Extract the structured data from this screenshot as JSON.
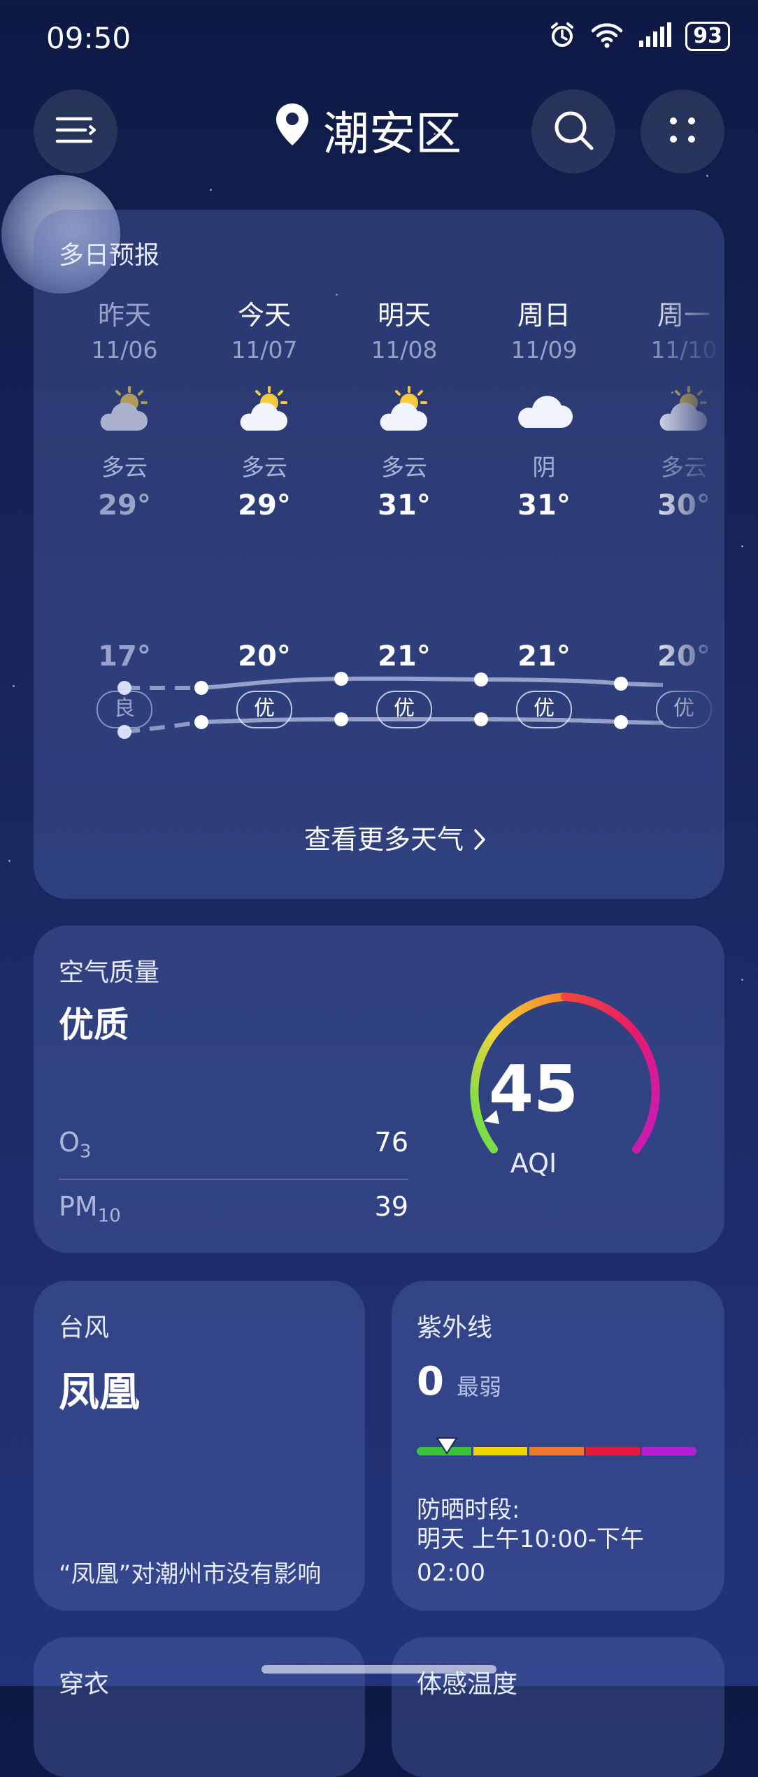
{
  "status_bar": {
    "time": "09:50",
    "battery": "93"
  },
  "header": {
    "location": "潮安区"
  },
  "forecast": {
    "title": "多日预报",
    "days": [
      {
        "name": "昨天",
        "date": "11/06",
        "condition": "多云",
        "high": "29°",
        "low": "17°",
        "aqi": "良",
        "icon": "partly-cloudy-icon"
      },
      {
        "name": "今天",
        "date": "11/07",
        "condition": "多云",
        "high": "29°",
        "low": "20°",
        "aqi": "优",
        "icon": "partly-cloudy-icon"
      },
      {
        "name": "明天",
        "date": "11/08",
        "condition": "多云",
        "high": "31°",
        "low": "21°",
        "aqi": "优",
        "icon": "partly-cloudy-icon"
      },
      {
        "name": "周日",
        "date": "11/09",
        "condition": "阴",
        "high": "31°",
        "low": "21°",
        "aqi": "优",
        "icon": "cloud-icon"
      },
      {
        "name": "周一",
        "date": "11/10",
        "condition": "多云",
        "high": "30°",
        "low": "20°",
        "aqi": "优",
        "icon": "partly-cloudy-icon"
      }
    ],
    "more_link": "查看更多天气"
  },
  "air_quality": {
    "label": "空气质量",
    "level": "优质",
    "pollutants": [
      {
        "name": "O",
        "sub": "3",
        "value": "76"
      },
      {
        "name": "PM",
        "sub": "10",
        "value": "39"
      }
    ],
    "aqi": "45",
    "aqi_unit": "AQI",
    "aqi_fraction": 0.09
  },
  "typhoon": {
    "title": "台风",
    "name": "凤凰",
    "note": "“凤凰”对潮州市没有影响"
  },
  "uv": {
    "title": "紫外线",
    "value": "0",
    "level": "最弱",
    "protect_label": "防晒时段:",
    "protect_time": "明天 上午10:00-下午02:00"
  },
  "bottom": {
    "left_title": "穿衣",
    "right_title": "体感温度"
  },
  "colors": {
    "uv_scale": [
      "#39c23a",
      "#f2d500",
      "#f07a2b",
      "#e8193c",
      "#b21fd6"
    ]
  }
}
